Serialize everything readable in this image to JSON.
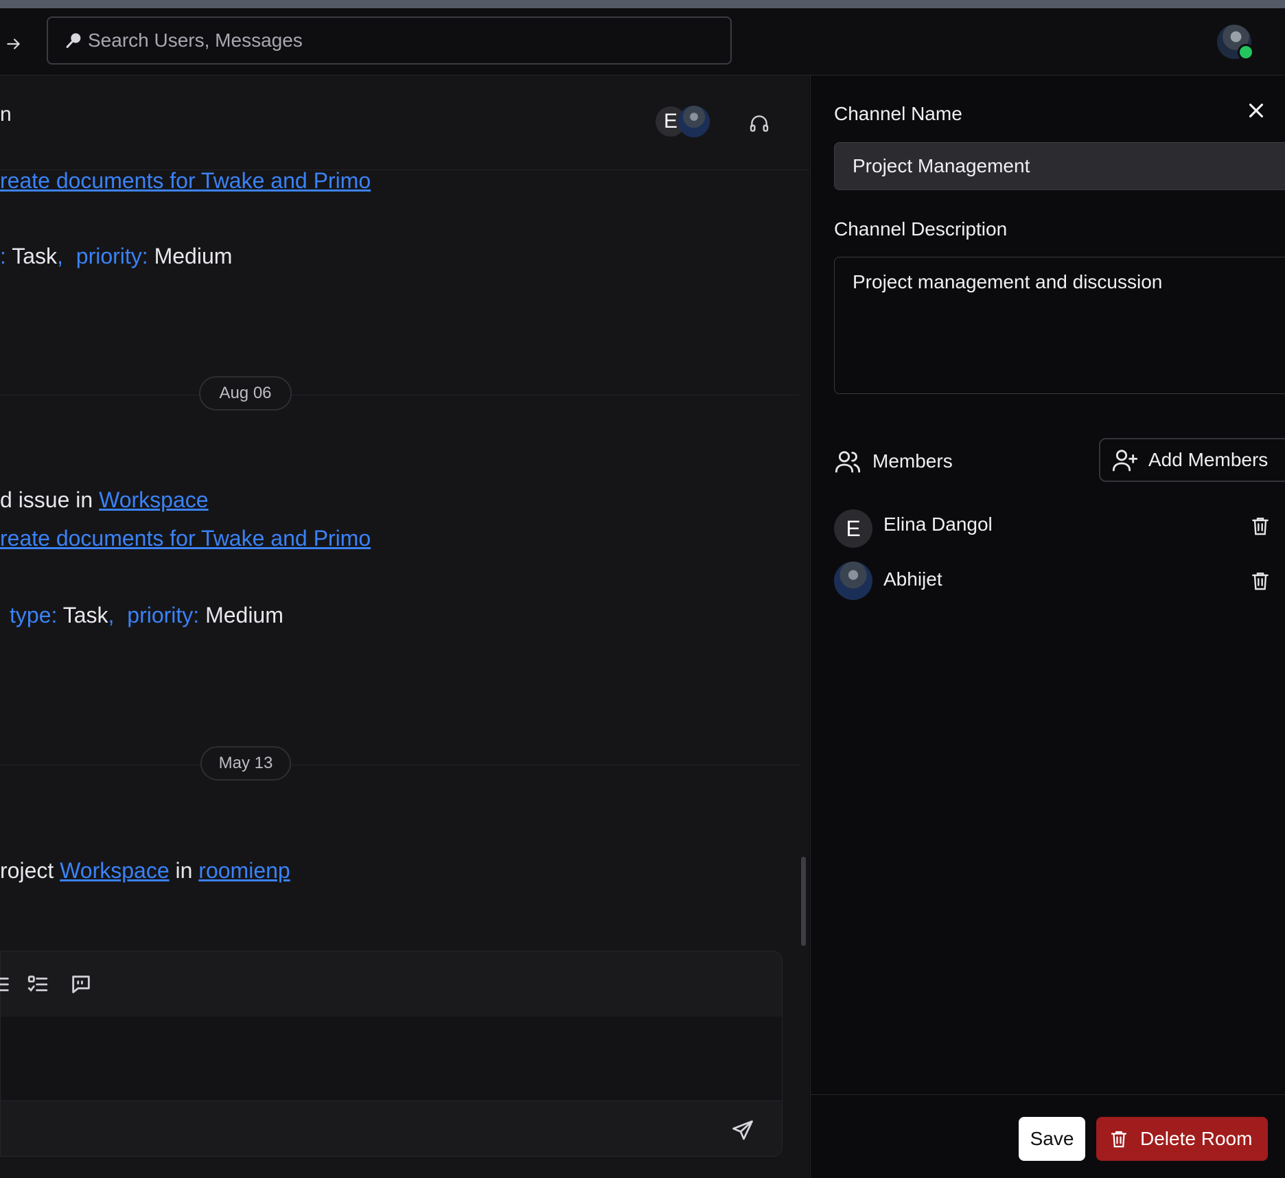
{
  "search": {
    "placeholder": "Search Users, Messages"
  },
  "chat": {
    "header_partial_char": "n",
    "avatar_initial": "E",
    "messages_top": {
      "link1": "reate documents for Twake and Primo",
      "type_value": "Task",
      "priority_key": "priority:",
      "priority_value": "Medium",
      "type_sep": ":",
      "comma": ","
    },
    "date1": "Aug 06",
    "messages_mid": {
      "issue_prefix": "d issue in ",
      "issue_link": "Workspace",
      "link2": "reate documents for Twake and Primo",
      "type_key": "type:",
      "type_value": "Task",
      "priority_key": "priority:",
      "priority_value": "Medium",
      "comma": ","
    },
    "date2": "May 13",
    "messages_bottom": {
      "prefix": "roject ",
      "link1": "Workspace",
      "mid": " in ",
      "link2": "roomienp"
    }
  },
  "panel": {
    "channel_name_label": "Channel Name",
    "channel_name_value": "Project Management",
    "channel_desc_label": "Channel Description",
    "channel_desc_value": "Project management and discussion",
    "members_label": "Members",
    "add_members_label": "Add Members",
    "members": [
      {
        "initial": "E",
        "name": "Elina Dangol"
      },
      {
        "initial": "",
        "name": "Abhijet"
      }
    ],
    "save_label": "Save",
    "delete_label": "Delete Room"
  },
  "colors": {
    "link": "#3b82f6",
    "danger": "#a11c1c",
    "online": "#22c55e"
  }
}
